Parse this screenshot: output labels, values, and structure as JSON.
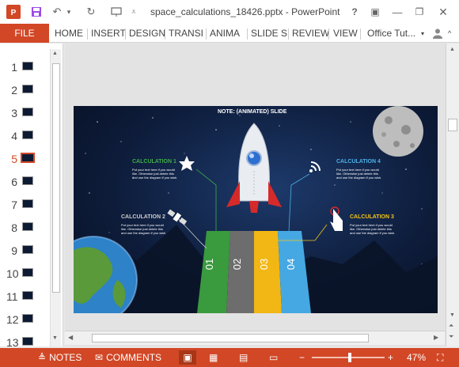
{
  "window": {
    "title": "space_calculations_18426.pptx - PowerPoint",
    "app_icon": "powerpoint-icon",
    "controls": [
      "help",
      "ribbon-display",
      "minimize",
      "restore",
      "close"
    ]
  },
  "ribbon": {
    "file_label": "FILE",
    "tabs": [
      "HOME",
      "INSERT",
      "DESIGN",
      "TRANSI",
      "ANIMA",
      "SLIDE S",
      "REVIEW",
      "VIEW"
    ],
    "account": "Office Tut..."
  },
  "thumbnails": {
    "active": 5,
    "items": [
      "1",
      "2",
      "3",
      "4",
      "5",
      "6",
      "7",
      "8",
      "9",
      "10",
      "11",
      "12",
      "13"
    ]
  },
  "slide": {
    "note": "NOTE: (ANIMATED) SLIDE",
    "calculations": [
      {
        "title": "CALCULATION 1",
        "desc": "Put your text here if you would like. Otherwise just delete this and use the diagram if you wish.",
        "color": "#3fae49",
        "icon": "star-icon"
      },
      {
        "title": "CALCULATION 2",
        "desc": "Put your text here if you would like. Otherwise just delete this and use the diagram if you wish.",
        "color": "#cccccc",
        "icon": "satellite-icon"
      },
      {
        "title": "CALCULATION 3",
        "desc": "Put your text here if you would like. Otherwise just delete this and use the diagram if you wish.",
        "color": "#f5c518",
        "icon": "touch-icon"
      },
      {
        "title": "CALCULATION 4",
        "desc": "Put your text here if you would like. Otherwise just delete this and use the diagram if you wish.",
        "color": "#4db0e8",
        "icon": "wifi-icon"
      }
    ],
    "stripes": [
      {
        "label": "01",
        "color": "#3a9a3e"
      },
      {
        "label": "02",
        "color": "#6d6d6d"
      },
      {
        "label": "03",
        "color": "#f2b714"
      },
      {
        "label": "04",
        "color": "#45a8e2"
      }
    ]
  },
  "statusbar": {
    "notes_label": "NOTES",
    "comments_label": "COMMENTS",
    "zoom_label": "47%",
    "zoom": 47
  }
}
